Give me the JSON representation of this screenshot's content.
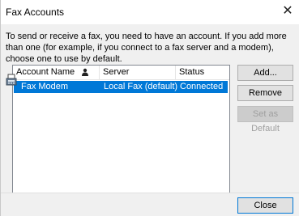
{
  "window": {
    "title": "Fax Accounts",
    "close_glyph": "✕"
  },
  "description": "To send or receive a fax, you need to have an account. If you add more than one (for example, if you connect to a fax server and a modem), choose one to use by default.",
  "accounts_list": {
    "columns": [
      "Account Name",
      "Server",
      "Status"
    ],
    "sort_icon": "person-icon",
    "rows": [
      {
        "icon": "fax-machine-icon",
        "account_name": "Fax Modem",
        "server": "Local Fax (default)",
        "status": "Connected",
        "selected": true
      }
    ]
  },
  "buttons": {
    "add": "Add...",
    "remove": "Remove",
    "set_default": "Set as Default",
    "close": "Close"
  },
  "colors": {
    "selection": "#0078d7",
    "dialog_bg": "#f0f0f0"
  }
}
